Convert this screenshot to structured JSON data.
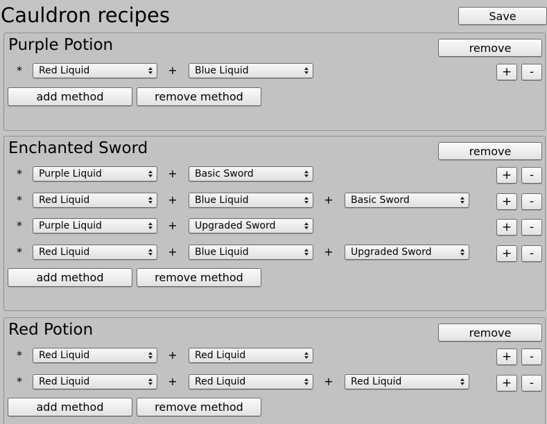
{
  "app": {
    "title": "Cauldron recipes",
    "save_label": "Save"
  },
  "labels": {
    "remove": "remove",
    "add_method": "add method",
    "remove_method": "remove method",
    "star": "*",
    "plus": "+",
    "increment": "+",
    "decrement": "-"
  },
  "icons": {
    "dropdown": "updown-arrows-icon"
  },
  "recipes": [
    {
      "name": "Purple Potion",
      "methods": [
        [
          "Red Liquid",
          "Blue Liquid"
        ]
      ]
    },
    {
      "name": "Enchanted Sword",
      "methods": [
        [
          "Purple Liquid",
          "Basic Sword"
        ],
        [
          "Red Liquid",
          "Blue Liquid",
          "Basic Sword"
        ],
        [
          "Purple Liquid",
          "Upgraded Sword"
        ],
        [
          "Red Liquid",
          "Blue Liquid",
          "Upgraded Sword"
        ]
      ]
    },
    {
      "name": "Red Potion",
      "methods": [
        [
          "Red Liquid",
          "Red Liquid"
        ],
        [
          "Red Liquid",
          "Red Liquid",
          "Red Liquid"
        ]
      ]
    }
  ]
}
